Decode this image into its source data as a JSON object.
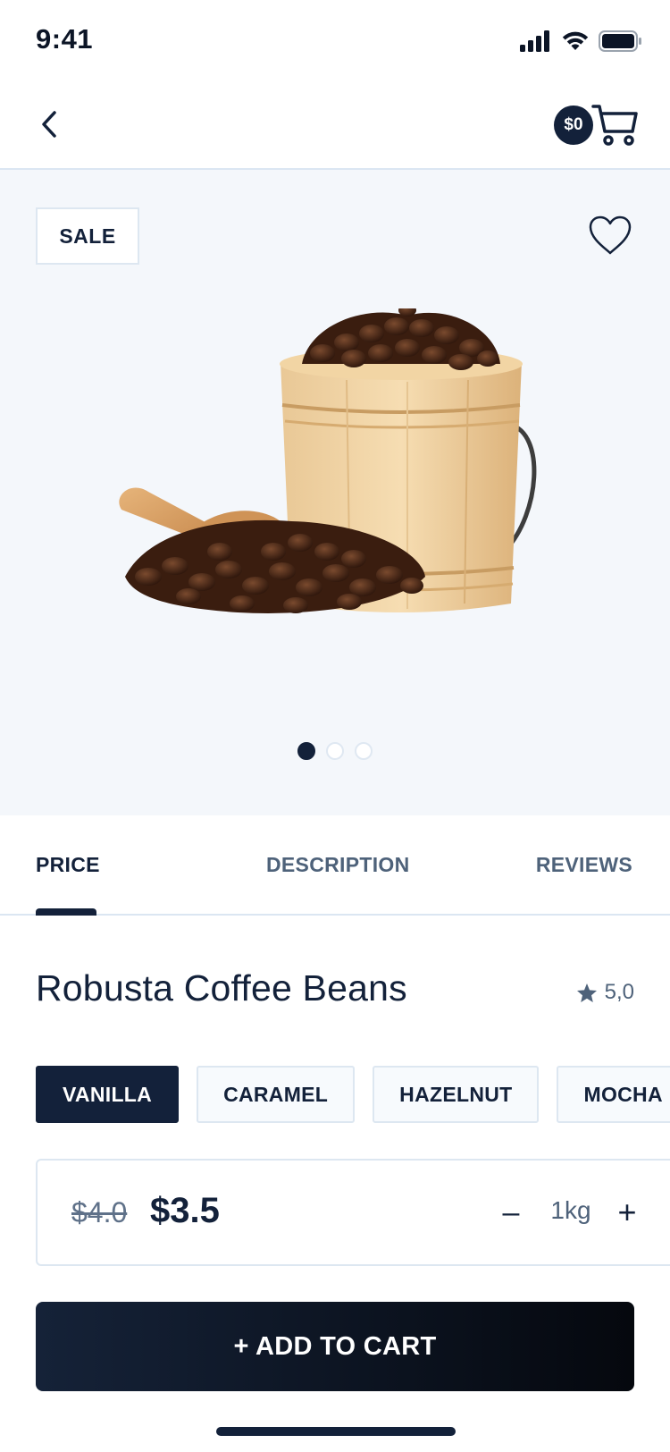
{
  "status_bar": {
    "time": "9:41"
  },
  "nav": {
    "cart_amount": "$0"
  },
  "hero": {
    "badge": "SALE",
    "carousel_count": 3,
    "carousel_active": 0
  },
  "tabs": [
    {
      "label": "PRICE",
      "active": true
    },
    {
      "label": "DESCRIPTION",
      "active": false
    },
    {
      "label": "REVIEWS",
      "active": false
    }
  ],
  "product": {
    "title": "Robusta Coffee Beans",
    "rating": "5,0",
    "flavors": [
      "VANILLA",
      "CARAMEL",
      "HAZELNUT",
      "MOCHA"
    ],
    "selected_flavor": "VANILLA",
    "old_price": "$4.0",
    "price": "$3.5",
    "quantity": "1kg",
    "minus_label": "–",
    "plus_label": "+"
  },
  "actions": {
    "add_to_cart": "+ ADD TO CART"
  },
  "colors": {
    "primary": "#13213a",
    "hero_bg": "#f4f7fb",
    "border": "#dde7f1",
    "muted": "#4e627a"
  },
  "icons": [
    "back-chevron-icon",
    "cart-icon",
    "heart-icon",
    "star-icon",
    "signal-icon",
    "wifi-icon",
    "battery-icon"
  ]
}
